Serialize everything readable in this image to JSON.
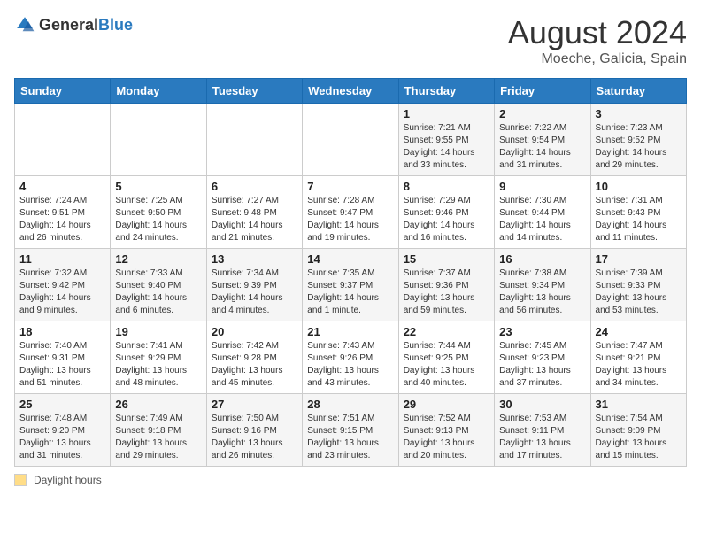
{
  "header": {
    "logo_general": "General",
    "logo_blue": "Blue",
    "month_year": "August 2024",
    "location": "Moeche, Galicia, Spain"
  },
  "weekdays": [
    "Sunday",
    "Monday",
    "Tuesday",
    "Wednesday",
    "Thursday",
    "Friday",
    "Saturday"
  ],
  "legend": {
    "label": "Daylight hours"
  },
  "weeks": [
    [
      {
        "day": "",
        "info": ""
      },
      {
        "day": "",
        "info": ""
      },
      {
        "day": "",
        "info": ""
      },
      {
        "day": "",
        "info": ""
      },
      {
        "day": "1",
        "info": "Sunrise: 7:21 AM\nSunset: 9:55 PM\nDaylight: 14 hours\nand 33 minutes."
      },
      {
        "day": "2",
        "info": "Sunrise: 7:22 AM\nSunset: 9:54 PM\nDaylight: 14 hours\nand 31 minutes."
      },
      {
        "day": "3",
        "info": "Sunrise: 7:23 AM\nSunset: 9:52 PM\nDaylight: 14 hours\nand 29 minutes."
      }
    ],
    [
      {
        "day": "4",
        "info": "Sunrise: 7:24 AM\nSunset: 9:51 PM\nDaylight: 14 hours\nand 26 minutes."
      },
      {
        "day": "5",
        "info": "Sunrise: 7:25 AM\nSunset: 9:50 PM\nDaylight: 14 hours\nand 24 minutes."
      },
      {
        "day": "6",
        "info": "Sunrise: 7:27 AM\nSunset: 9:48 PM\nDaylight: 14 hours\nand 21 minutes."
      },
      {
        "day": "7",
        "info": "Sunrise: 7:28 AM\nSunset: 9:47 PM\nDaylight: 14 hours\nand 19 minutes."
      },
      {
        "day": "8",
        "info": "Sunrise: 7:29 AM\nSunset: 9:46 PM\nDaylight: 14 hours\nand 16 minutes."
      },
      {
        "day": "9",
        "info": "Sunrise: 7:30 AM\nSunset: 9:44 PM\nDaylight: 14 hours\nand 14 minutes."
      },
      {
        "day": "10",
        "info": "Sunrise: 7:31 AM\nSunset: 9:43 PM\nDaylight: 14 hours\nand 11 minutes."
      }
    ],
    [
      {
        "day": "11",
        "info": "Sunrise: 7:32 AM\nSunset: 9:42 PM\nDaylight: 14 hours\nand 9 minutes."
      },
      {
        "day": "12",
        "info": "Sunrise: 7:33 AM\nSunset: 9:40 PM\nDaylight: 14 hours\nand 6 minutes."
      },
      {
        "day": "13",
        "info": "Sunrise: 7:34 AM\nSunset: 9:39 PM\nDaylight: 14 hours\nand 4 minutes."
      },
      {
        "day": "14",
        "info": "Sunrise: 7:35 AM\nSunset: 9:37 PM\nDaylight: 14 hours\nand 1 minute."
      },
      {
        "day": "15",
        "info": "Sunrise: 7:37 AM\nSunset: 9:36 PM\nDaylight: 13 hours\nand 59 minutes."
      },
      {
        "day": "16",
        "info": "Sunrise: 7:38 AM\nSunset: 9:34 PM\nDaylight: 13 hours\nand 56 minutes."
      },
      {
        "day": "17",
        "info": "Sunrise: 7:39 AM\nSunset: 9:33 PM\nDaylight: 13 hours\nand 53 minutes."
      }
    ],
    [
      {
        "day": "18",
        "info": "Sunrise: 7:40 AM\nSunset: 9:31 PM\nDaylight: 13 hours\nand 51 minutes."
      },
      {
        "day": "19",
        "info": "Sunrise: 7:41 AM\nSunset: 9:29 PM\nDaylight: 13 hours\nand 48 minutes."
      },
      {
        "day": "20",
        "info": "Sunrise: 7:42 AM\nSunset: 9:28 PM\nDaylight: 13 hours\nand 45 minutes."
      },
      {
        "day": "21",
        "info": "Sunrise: 7:43 AM\nSunset: 9:26 PM\nDaylight: 13 hours\nand 43 minutes."
      },
      {
        "day": "22",
        "info": "Sunrise: 7:44 AM\nSunset: 9:25 PM\nDaylight: 13 hours\nand 40 minutes."
      },
      {
        "day": "23",
        "info": "Sunrise: 7:45 AM\nSunset: 9:23 PM\nDaylight: 13 hours\nand 37 minutes."
      },
      {
        "day": "24",
        "info": "Sunrise: 7:47 AM\nSunset: 9:21 PM\nDaylight: 13 hours\nand 34 minutes."
      }
    ],
    [
      {
        "day": "25",
        "info": "Sunrise: 7:48 AM\nSunset: 9:20 PM\nDaylight: 13 hours\nand 31 minutes."
      },
      {
        "day": "26",
        "info": "Sunrise: 7:49 AM\nSunset: 9:18 PM\nDaylight: 13 hours\nand 29 minutes."
      },
      {
        "day": "27",
        "info": "Sunrise: 7:50 AM\nSunset: 9:16 PM\nDaylight: 13 hours\nand 26 minutes."
      },
      {
        "day": "28",
        "info": "Sunrise: 7:51 AM\nSunset: 9:15 PM\nDaylight: 13 hours\nand 23 minutes."
      },
      {
        "day": "29",
        "info": "Sunrise: 7:52 AM\nSunset: 9:13 PM\nDaylight: 13 hours\nand 20 minutes."
      },
      {
        "day": "30",
        "info": "Sunrise: 7:53 AM\nSunset: 9:11 PM\nDaylight: 13 hours\nand 17 minutes."
      },
      {
        "day": "31",
        "info": "Sunrise: 7:54 AM\nSunset: 9:09 PM\nDaylight: 13 hours\nand 15 minutes."
      }
    ]
  ]
}
